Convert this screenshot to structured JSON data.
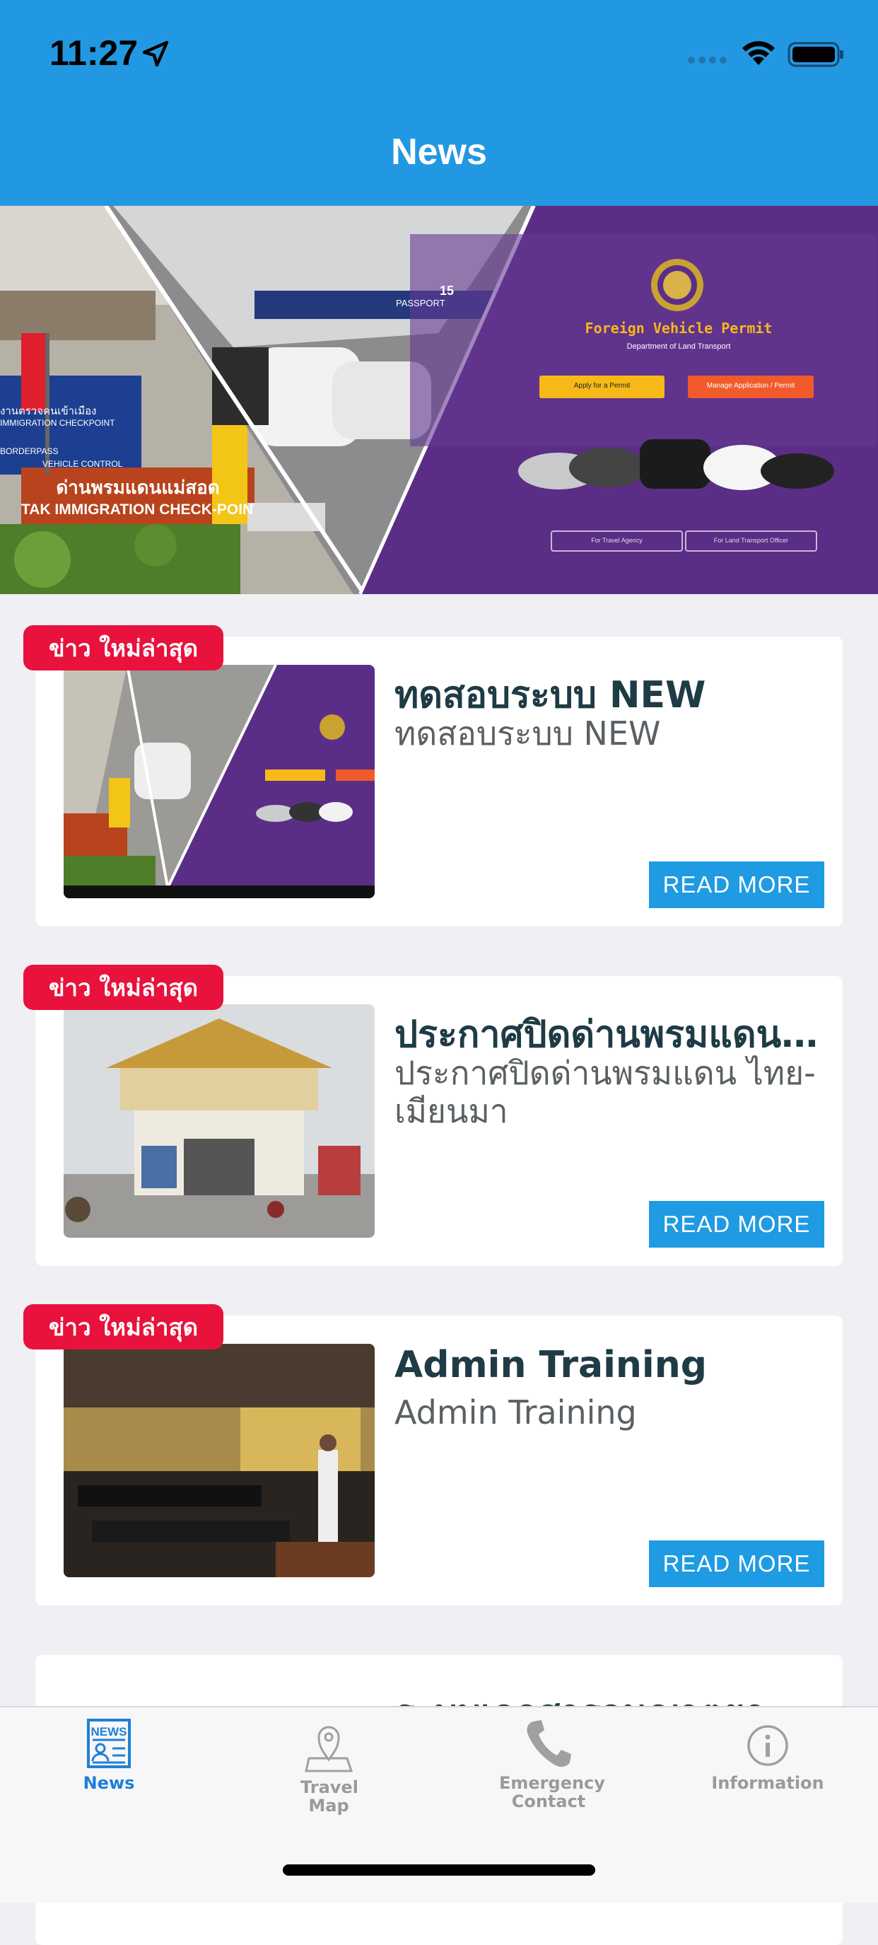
{
  "status_bar": {
    "time": "11:27"
  },
  "nav": {
    "title": "News"
  },
  "banner": {
    "title": "Foreign Vehicle Permit",
    "subtitle": "Department of Land Transport",
    "apply_label": "Apply for a Permit",
    "manage_label": "Manage Application / Permit",
    "agency_label": "For Travel Agency",
    "officer_label": "For Land Transport Officer",
    "sign_line1": "ด่านพรมแดนแม่สอด",
    "sign_line2": "TAK IMMIGRATION CHECK-POINT",
    "sign_blue_line1": "งานตรวจคนเข้าเมือง",
    "sign_blue_line2": "IMMIGRATION CHECKPOINT",
    "sign_blue_line3": "BORDERPASS",
    "sign_blue_line4": "VEHICLE CONTROL",
    "passport_label": "PASSPORT",
    "lane_label": "15"
  },
  "news": [
    {
      "badge": "ข่าว ใหม่ล่าสุด",
      "title": "ทดสอบระบบ NEW",
      "subtitle": "ทดสอบระบบ NEW",
      "read_more": "READ MORE"
    },
    {
      "badge": "ข่าว ใหม่ล่าสุด",
      "title": "ประกาศปิดด่านพรมแดน ไทย-เมียนมา",
      "subtitle": "ประกาศปิดด่านพรมแดน ไทย-เมียนมา",
      "read_more": "READ MORE"
    },
    {
      "badge": "ข่าว ใหม่ล่าสุด",
      "title": "Admin Training",
      "subtitle": "Admin Training",
      "read_more": "READ MORE"
    },
    {
      "title": "ระบบเอกสารอนุญาตยานพาหนะ"
    }
  ],
  "tabs": [
    {
      "label": "News",
      "icon": "news-icon",
      "active": true
    },
    {
      "label": "Travel Map",
      "icon": "map-pin-icon",
      "active": false
    },
    {
      "label": "Emergency Contact",
      "icon": "phone-icon",
      "active": false
    },
    {
      "label": "Information",
      "icon": "info-icon",
      "active": false
    }
  ],
  "colors": {
    "primary": "#2398e2",
    "badge": "#e8123c",
    "read_more": "#1e9be3",
    "tab_active": "#1e7fd9"
  }
}
